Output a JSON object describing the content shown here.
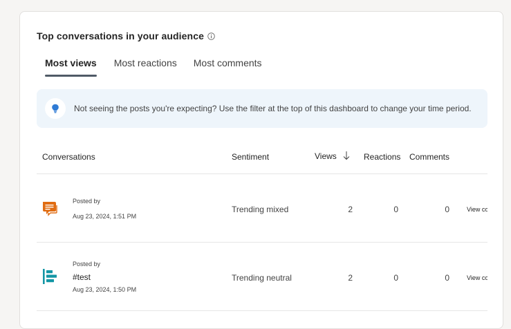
{
  "card": {
    "title": "Top conversations in your audience",
    "tabs": [
      {
        "label": "Most views",
        "active": true
      },
      {
        "label": "Most reactions",
        "active": false
      },
      {
        "label": "Most comments",
        "active": false
      }
    ],
    "notice": "Not seeing the posts you're expecting? Use the filter at the top of this dashboard to change your time period."
  },
  "table": {
    "columns": {
      "conversations": "Conversations",
      "sentiment": "Sentiment",
      "views": "Views",
      "reactions": "Reactions",
      "comments": "Comments"
    },
    "rows": [
      {
        "icon": "chat-bubbles-icon",
        "icon_color": "#e06c12",
        "posted_by": "Posted by",
        "hashtag": "",
        "date": "Aug 23, 2024, 1:51 PM",
        "sentiment": "Trending mixed",
        "views": "2",
        "reactions": "0",
        "comments": "0",
        "link": "View conversation"
      },
      {
        "icon": "align-bars-icon",
        "icon_color": "#1396a5",
        "posted_by": "Posted by",
        "hashtag": "#test",
        "date": "Aug 23, 2024, 1:50 PM",
        "sentiment": "Trending neutral",
        "views": "2",
        "reactions": "0",
        "comments": "0",
        "link": "View conversation"
      }
    ]
  },
  "colors": {
    "tab_indicator": "#4f5a66",
    "notice_bg": "#eef5fb",
    "bulb": "#2f7bd5"
  }
}
